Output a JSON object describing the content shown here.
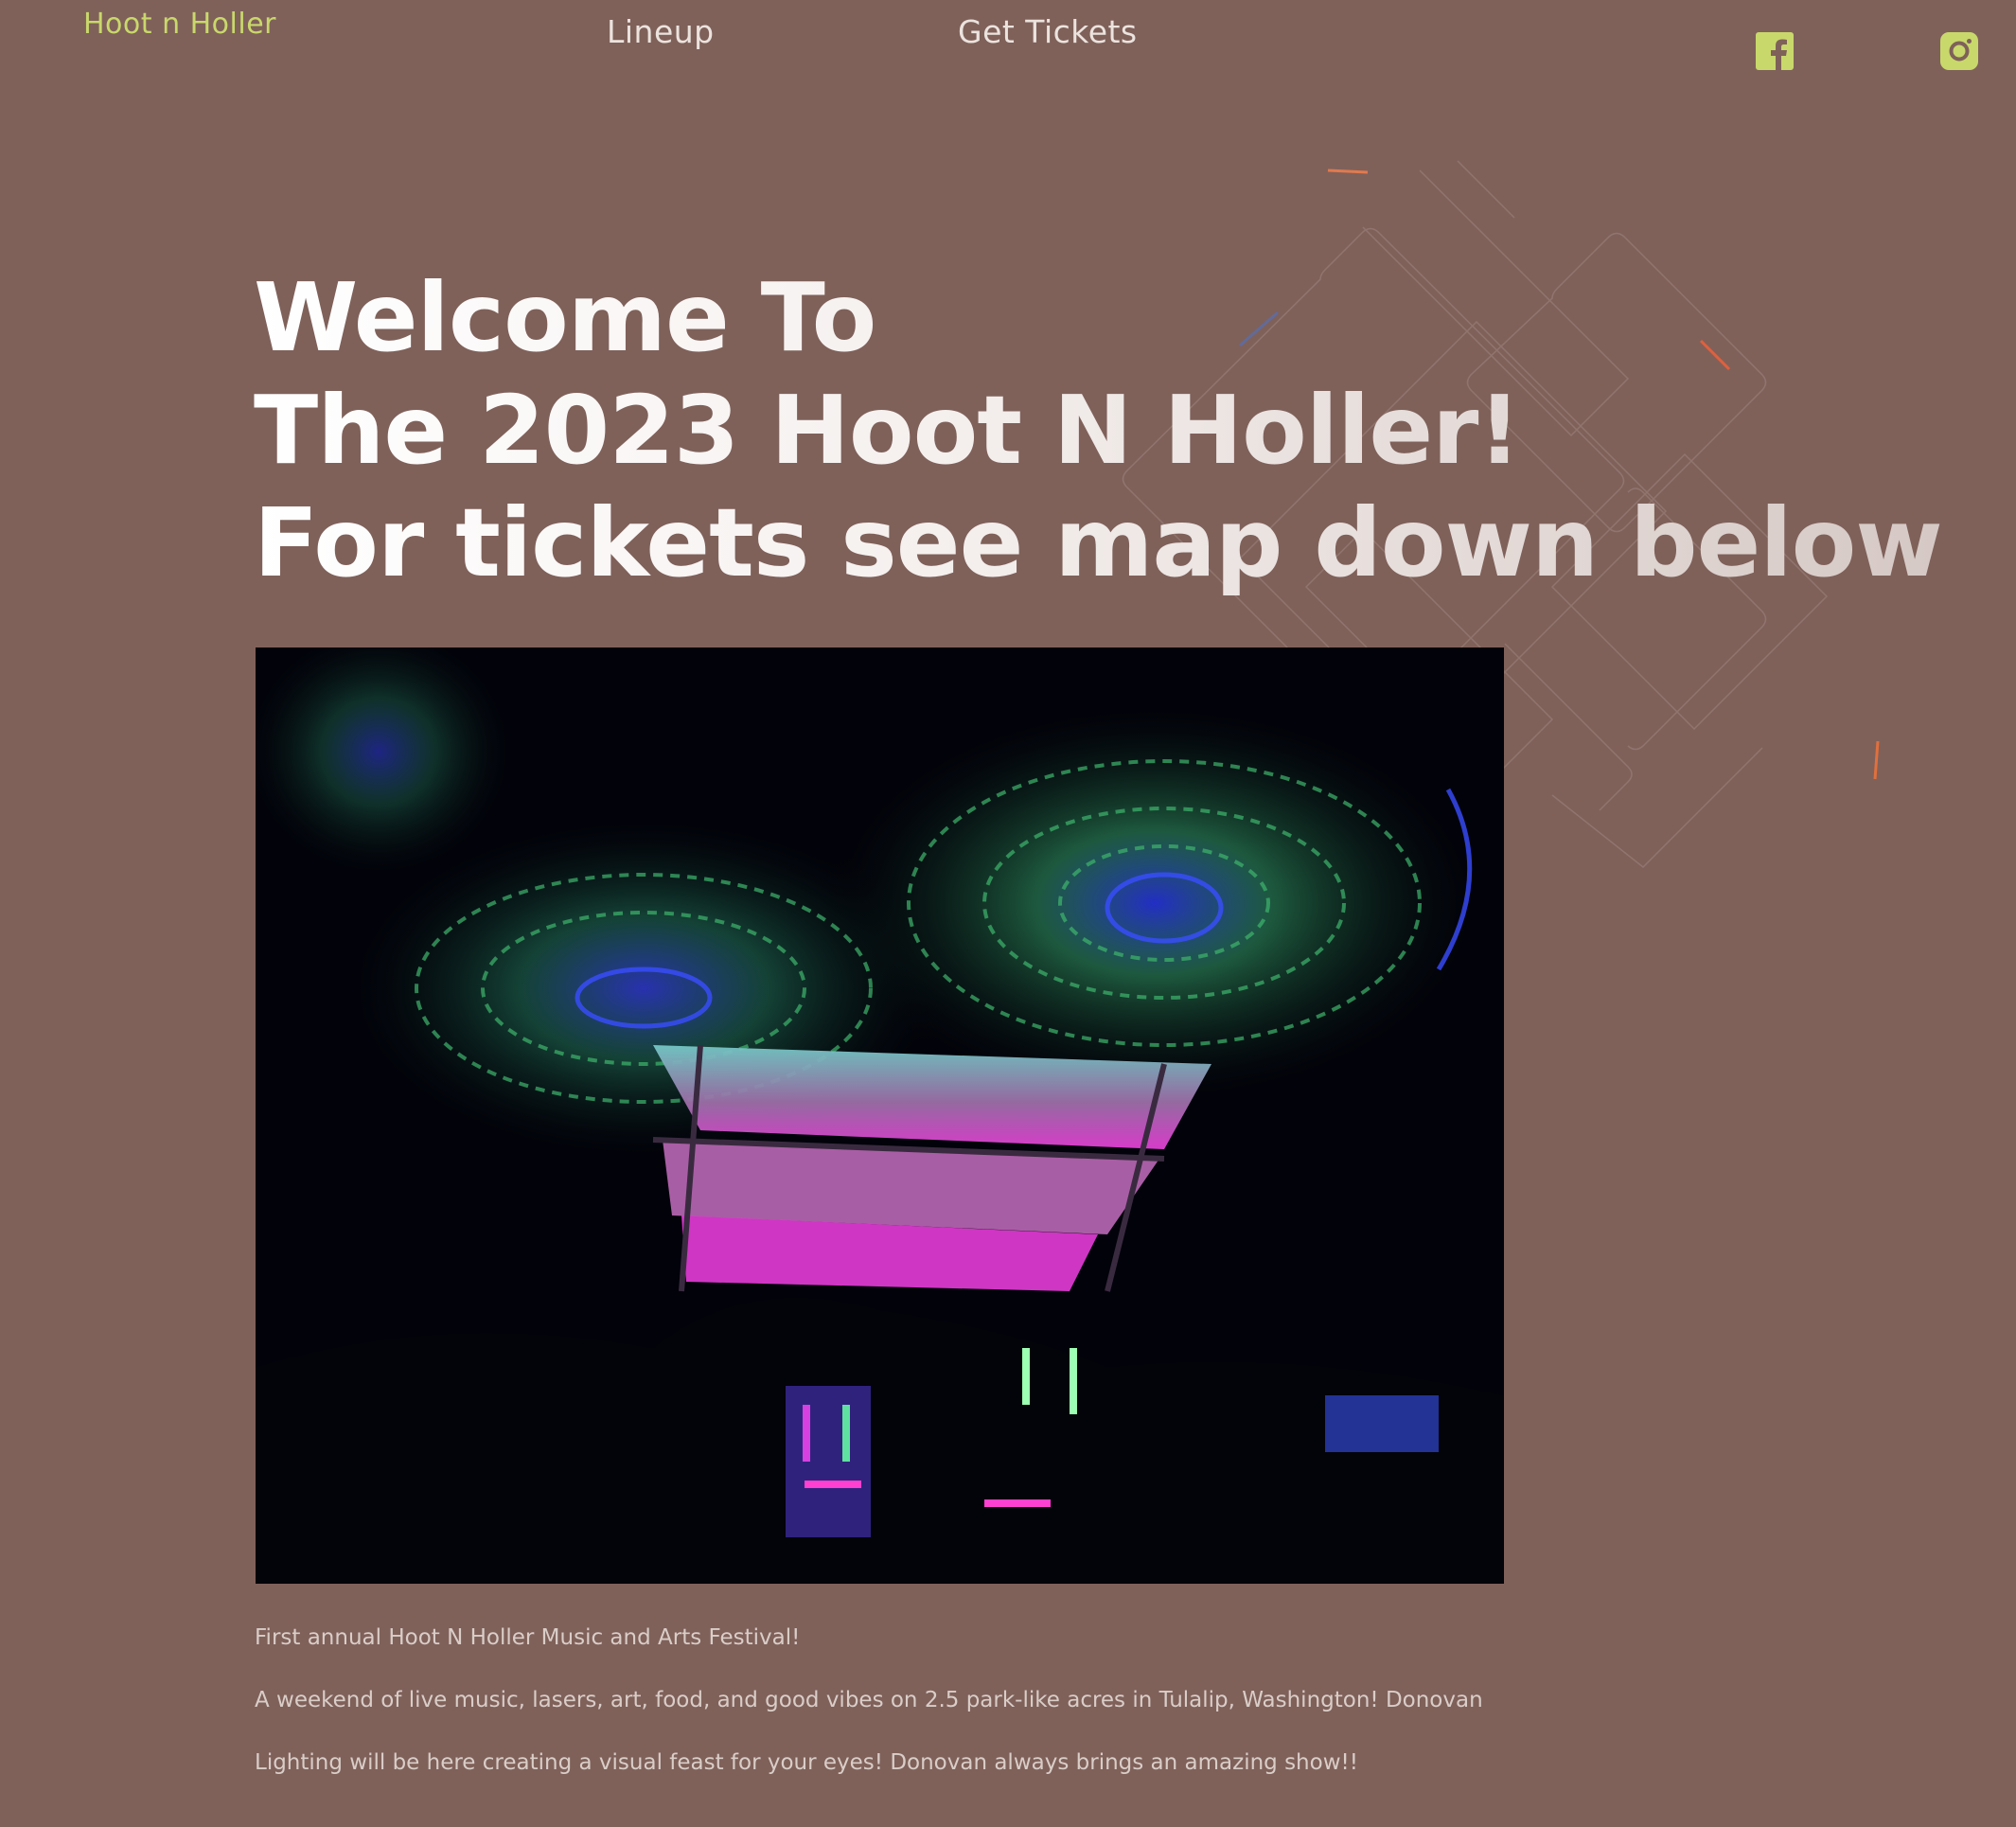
{
  "header": {
    "logo": "Hoot n Holler",
    "nav": [
      {
        "label": "Lineup"
      },
      {
        "label": "Get Tickets"
      }
    ],
    "social": [
      {
        "icon": "facebook-icon"
      },
      {
        "icon": "instagram-icon"
      }
    ]
  },
  "hero": {
    "headline_lines": [
      "Welcome To",
      "The 2023 Hoot N Holler!",
      "For tickets see map down below"
    ]
  },
  "content": {
    "paragraphs": [
      "First annual Hoot N Holler Music and Arts Festival!",
      "A weekend of live music, lasers, art, food, and good vibes on 2.5 park-like acres in Tulalip, Washington! Donovan",
      "Lighting will be here creating a visual feast for your eyes! Donovan always brings an amazing show!!"
    ]
  },
  "colors": {
    "background": "#7f615a",
    "accent": "#c9d86b",
    "nav_text": "#ece3de",
    "body_text": "#dacdc8"
  }
}
